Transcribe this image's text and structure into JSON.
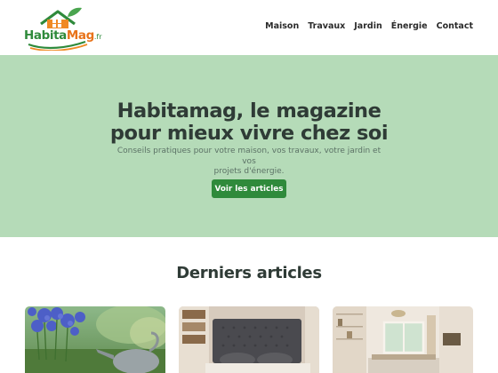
{
  "header": {
    "logo": {
      "text_habita": "Habita",
      "text_mag": "Mag",
      "text_tld": ".fr"
    },
    "nav": [
      {
        "label": "Maison"
      },
      {
        "label": "Travaux"
      },
      {
        "label": "Jardin"
      },
      {
        "label": "Énergie"
      },
      {
        "label": "Contact"
      }
    ]
  },
  "hero": {
    "title_line1": "Habitamag, le magazine",
    "title_line2": "pour mieux vivre chez soi",
    "subtitle_line1": "Conseils pratiques pour votre maison, vos travaux, votre jardin et vos",
    "subtitle_line2": "projets d'énergie.",
    "cta_label": "Voir les articles"
  },
  "articles_section": {
    "title": "Derniers articles",
    "cards": [
      {
        "image": "garden-agapanthus-watering-can"
      },
      {
        "image": "bedroom-upholstered-headboard"
      },
      {
        "image": "bedroom-window-shelving"
      }
    ]
  },
  "colors": {
    "brand_green": "#2f8a3b",
    "brand_orange": "#e8731a",
    "hero_background": "#b5dbb8",
    "heading_text": "#2f3b36"
  }
}
